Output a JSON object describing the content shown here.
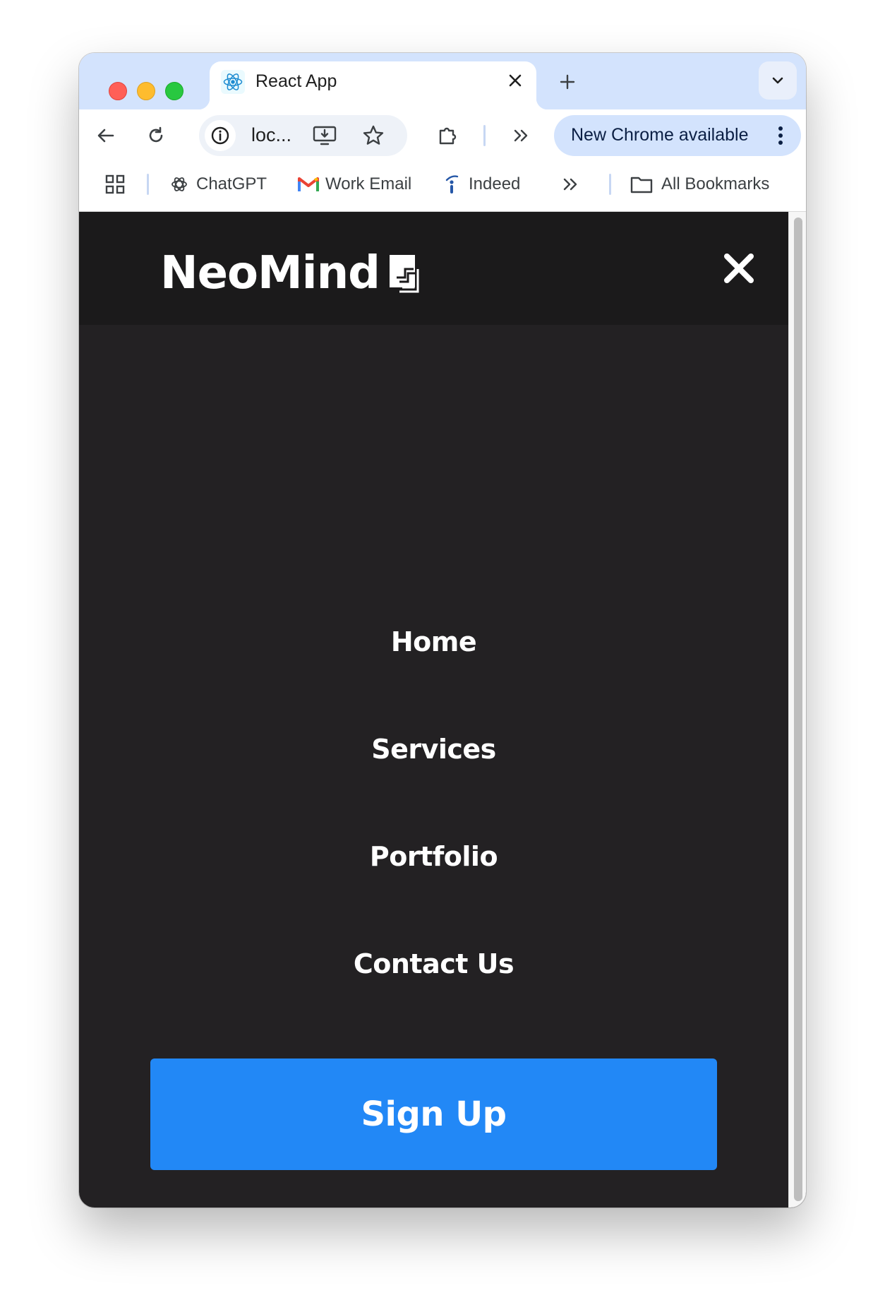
{
  "browser": {
    "tab": {
      "title": "React App",
      "favicon": "react-icon"
    },
    "toolbar": {
      "url": "loc...",
      "update_label": "New Chrome available"
    },
    "bookmarks": {
      "items": [
        {
          "label": "ChatGPT",
          "icon": "chatgpt-icon"
        },
        {
          "label": "Work Email",
          "icon": "gmail-icon"
        },
        {
          "label": "Indeed",
          "icon": "indeed-icon"
        }
      ],
      "all_label": "All Bookmarks"
    }
  },
  "page": {
    "logo_text": "NeoMind",
    "menu": [
      {
        "label": "Home"
      },
      {
        "label": "Services"
      },
      {
        "label": "Portfolio"
      },
      {
        "label": "Contact Us"
      }
    ],
    "signup_label": "Sign Up",
    "colors": {
      "background": "#232123",
      "header": "#1b1a1b",
      "accent": "#2288f6"
    }
  }
}
